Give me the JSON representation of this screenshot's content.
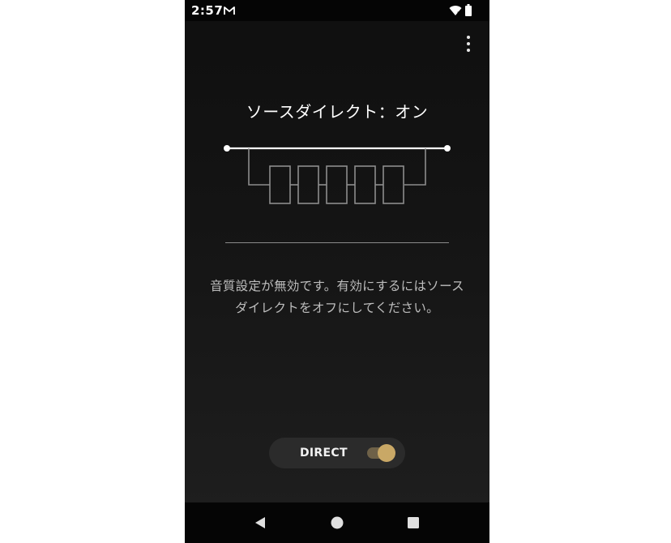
{
  "status_bar": {
    "time": "2:57",
    "icons": [
      "gmail-icon",
      "wifi-icon",
      "battery-icon"
    ]
  },
  "toolbar": {
    "overflow_icon": "more-vert-icon"
  },
  "title": "ソースダイレクト：オン",
  "diagram": {
    "icon": "source-direct-bypass-diagram",
    "eq_blocks": 5
  },
  "message": {
    "line1": "音質設定が無効です。有効にするにはソース",
    "line2": "ダイレクトをオフにしてください。"
  },
  "direct_toggle": {
    "label": "DIRECT",
    "state": "on",
    "accent_color": "#c9a866"
  },
  "nav_bar": {
    "buttons": [
      "back-icon",
      "home-icon",
      "recents-icon"
    ]
  },
  "colors": {
    "background": "#141414",
    "text_primary": "#ffffff",
    "text_secondary": "#bdbdbd",
    "accent": "#c9a866"
  }
}
